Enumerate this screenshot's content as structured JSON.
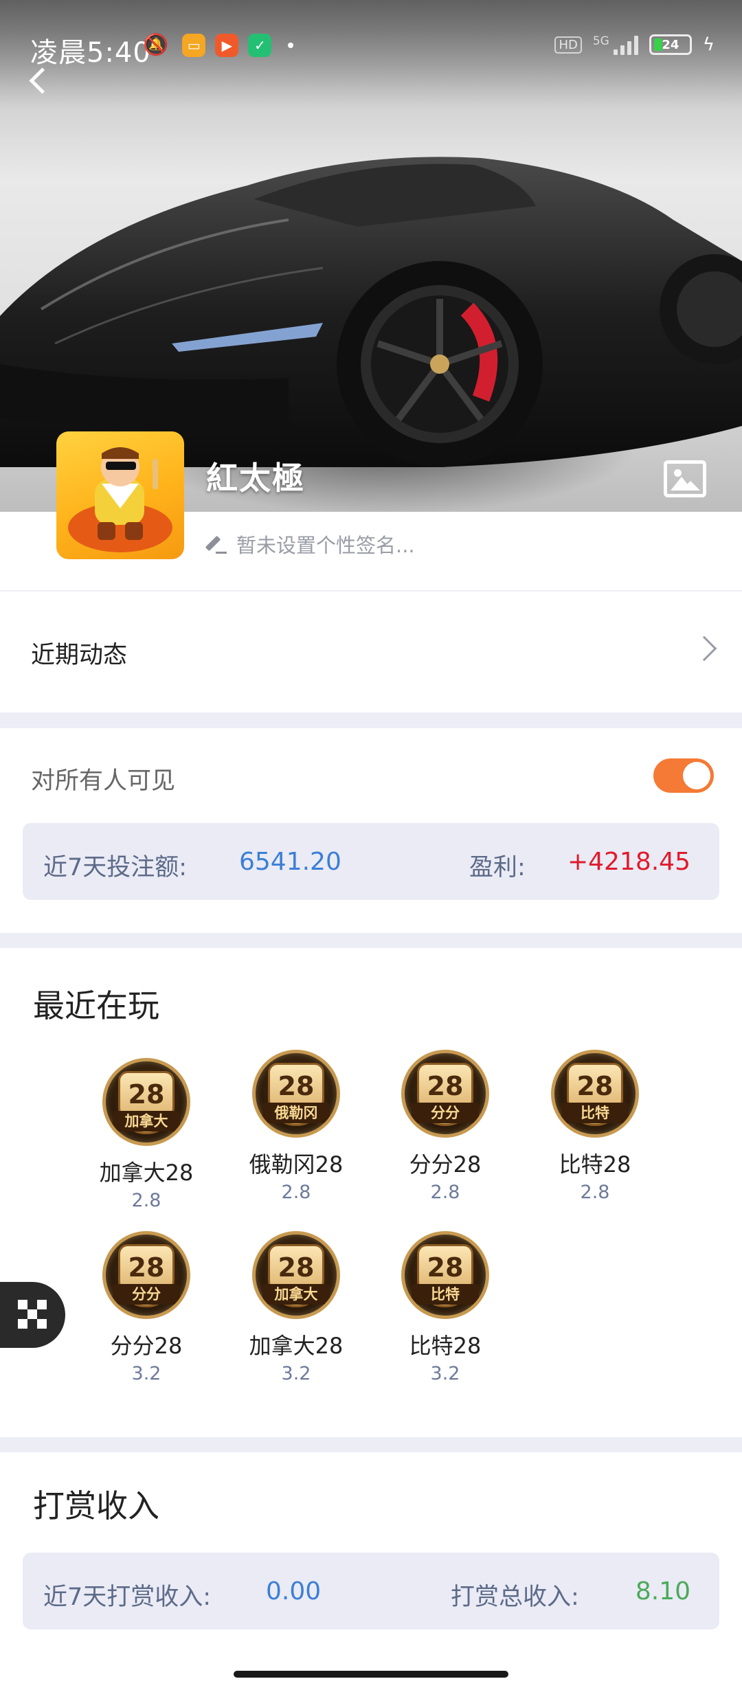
{
  "status_bar": {
    "time": "凌晨5:40",
    "battery": "24",
    "network": "5G",
    "hd_label": "HD"
  },
  "profile": {
    "nickname": "紅太極",
    "signature": "暂未设置个性签名..."
  },
  "recent_activity": {
    "label": "近期动态"
  },
  "visibility": {
    "label": "对所有人可见",
    "enabled": true
  },
  "stats": {
    "bet_label": "近7天投注额:",
    "bet_value": "6541.20",
    "profit_label": "盈利:",
    "profit_value": "+4218.45"
  },
  "games_section": {
    "title": "最近在玩",
    "games": [
      {
        "name": "加拿大28",
        "rate": "2.8",
        "badge": "加拿大"
      },
      {
        "name": "俄勒冈28",
        "rate": "2.8",
        "badge": "俄勒冈"
      },
      {
        "name": "分分28",
        "rate": "2.8",
        "badge": "分分"
      },
      {
        "name": "比特28",
        "rate": "2.8",
        "badge": "比特"
      },
      {
        "name": "分分28",
        "rate": "3.2",
        "badge": "分分"
      },
      {
        "name": "加拿大28",
        "rate": "3.2",
        "badge": "加拿大"
      },
      {
        "name": "比特28",
        "rate": "3.2",
        "badge": "比特"
      }
    ],
    "icon_number": "28"
  },
  "tips": {
    "title": "打赏收入",
    "recent_label": "近7天打赏收入:",
    "recent_value": "0.00",
    "total_label": "打赏总收入:",
    "total_value": "8.10"
  },
  "colors": {
    "accent_orange": "#f47a35",
    "value_blue": "#3b7fd6",
    "profit_red": "#e01b2c",
    "total_green": "#4aaa5a"
  }
}
